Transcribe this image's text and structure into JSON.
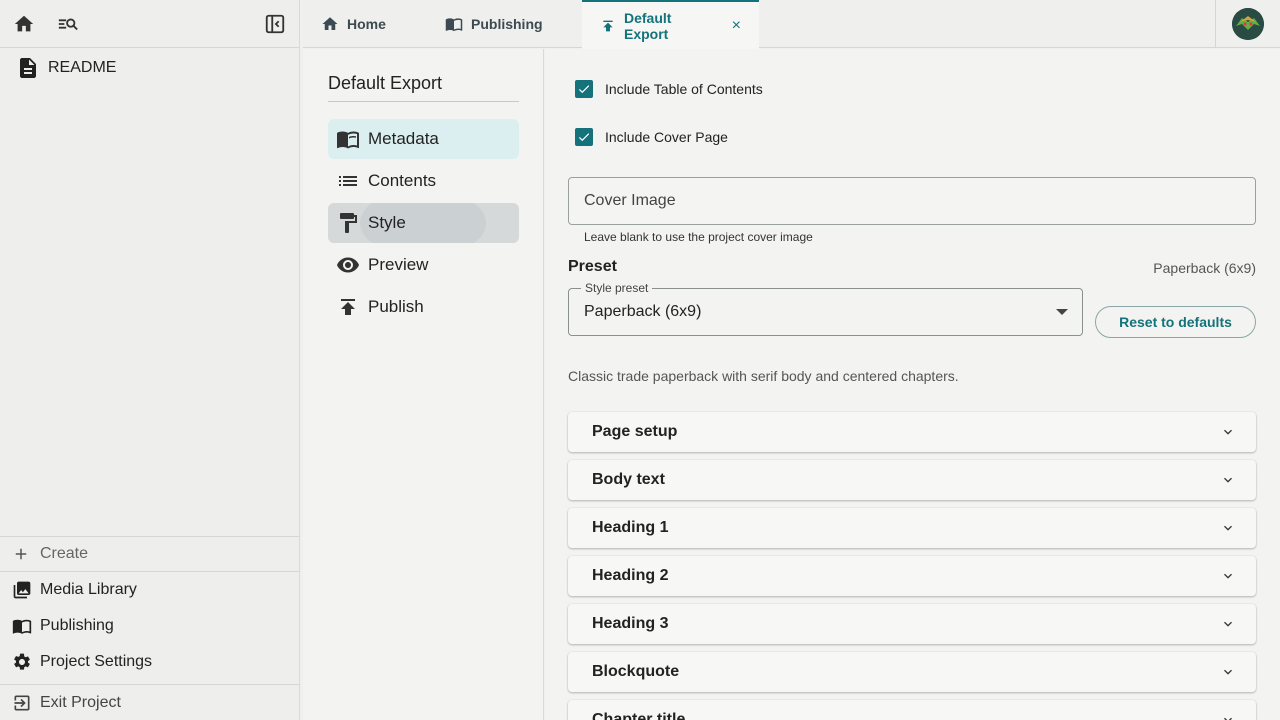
{
  "sidebar": {
    "readme": "README",
    "create": "Create",
    "nav": [
      "Media Library",
      "Publishing",
      "Project Settings"
    ],
    "exit": "Exit Project"
  },
  "tabs": [
    {
      "label": "Home",
      "icon": "home-icon"
    },
    {
      "label": "Publishing",
      "icon": "publishing-icon"
    },
    {
      "label": "Default Export",
      "icon": "publish-icon",
      "active": true,
      "close": "×"
    }
  ],
  "midnav": {
    "title": "Default Export",
    "items": [
      "Metadata",
      "Contents",
      "Style",
      "Preview",
      "Publish"
    ]
  },
  "main": {
    "toc_label": "Include Table of Contents",
    "toc_checked": true,
    "cover_page_label": "Include Cover Page",
    "cover_page_checked": true,
    "cover_image_label": "Cover Image",
    "cover_image_helper": "Leave blank to use the project cover image",
    "preset_heading": "Preset",
    "preset_current": "Paperback (6x9)",
    "style_preset_label": "Style preset",
    "style_preset_value": "Paperback (6x9)",
    "reset_label": "Reset to defaults",
    "preset_description": "Classic trade paperback with serif body and centered chapters.",
    "sections": [
      "Page setup",
      "Body text",
      "Heading 1",
      "Heading 2",
      "Heading 3",
      "Blockquote",
      "Chapter title"
    ]
  },
  "colors": {
    "accent": "#14727a",
    "selected_bg": "#dceff0"
  }
}
